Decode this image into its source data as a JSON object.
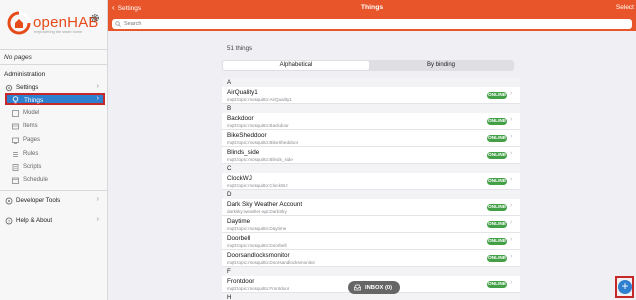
{
  "app": {
    "logo_text": "openHAB",
    "logo_tagline": "empowering the smart home"
  },
  "sidebar": {
    "no_pages": "No pages",
    "section_admin": "Administration",
    "settings_label": "Settings",
    "things_label": "Things",
    "sub_items": [
      "Model",
      "Items",
      "Pages",
      "Rules",
      "Scripts",
      "Schedule"
    ],
    "developer_tools": "Developer Tools",
    "help_about": "Help & About"
  },
  "header": {
    "back_label": "Settings",
    "title": "Things",
    "select_label": "Select"
  },
  "search": {
    "placeholder": "Search"
  },
  "main": {
    "count": "51 things",
    "tabs": [
      "Alphabetical",
      "By binding"
    ],
    "groups": [
      {
        "letter": "A",
        "items": [
          {
            "name": "AirQuality1",
            "uid": "mqtt:topic:mosquitto:AirQuality1",
            "status": "ONLINE"
          }
        ]
      },
      {
        "letter": "B",
        "items": [
          {
            "name": "Backdoor",
            "uid": "mqtt:topic:mosquitto:Backdoor",
            "status": "ONLINE"
          },
          {
            "name": "BikeSheddoor",
            "uid": "mqtt:topic:mosquitto:BikeSheddoor",
            "status": "ONLINE"
          },
          {
            "name": "Blinds_side",
            "uid": "mqtt:topic:mosquitto:Blinds_side",
            "status": "ONLINE"
          }
        ]
      },
      {
        "letter": "C",
        "items": [
          {
            "name": "ClockWJ",
            "uid": "mqtt:topic:mosquitto:ClockWJ",
            "status": "ONLINE"
          }
        ]
      },
      {
        "letter": "D",
        "items": [
          {
            "name": "Dark Sky Weather Account",
            "uid": "darksky:weather-api:DarkSky",
            "status": "ONLINE"
          },
          {
            "name": "Daytime",
            "uid": "mqtt:topic:mosquitto:Daytime",
            "status": "ONLINE"
          },
          {
            "name": "Doorbell",
            "uid": "mqtt:topic:mosquitto:Doorbell",
            "status": "ONLINE"
          },
          {
            "name": "Doorsandlocksmonitor",
            "uid": "mqtt:topic:mosquitto:Doorsandlocksmonitor",
            "status": "ONLINE"
          }
        ]
      },
      {
        "letter": "F",
        "items": [
          {
            "name": "Frontdoor",
            "uid": "mqtt:topic:mosquitto:Frontdoor",
            "status": "ONLINE"
          }
        ]
      },
      {
        "letter": "H",
        "items": []
      }
    ]
  },
  "inbox": {
    "label": "INBOX (0)"
  },
  "fab": {
    "label": "+"
  },
  "colors": {
    "accent": "#e8552a",
    "selected": "#2f7fd0",
    "online": "#43a047",
    "highlight_border": "#c62828"
  }
}
